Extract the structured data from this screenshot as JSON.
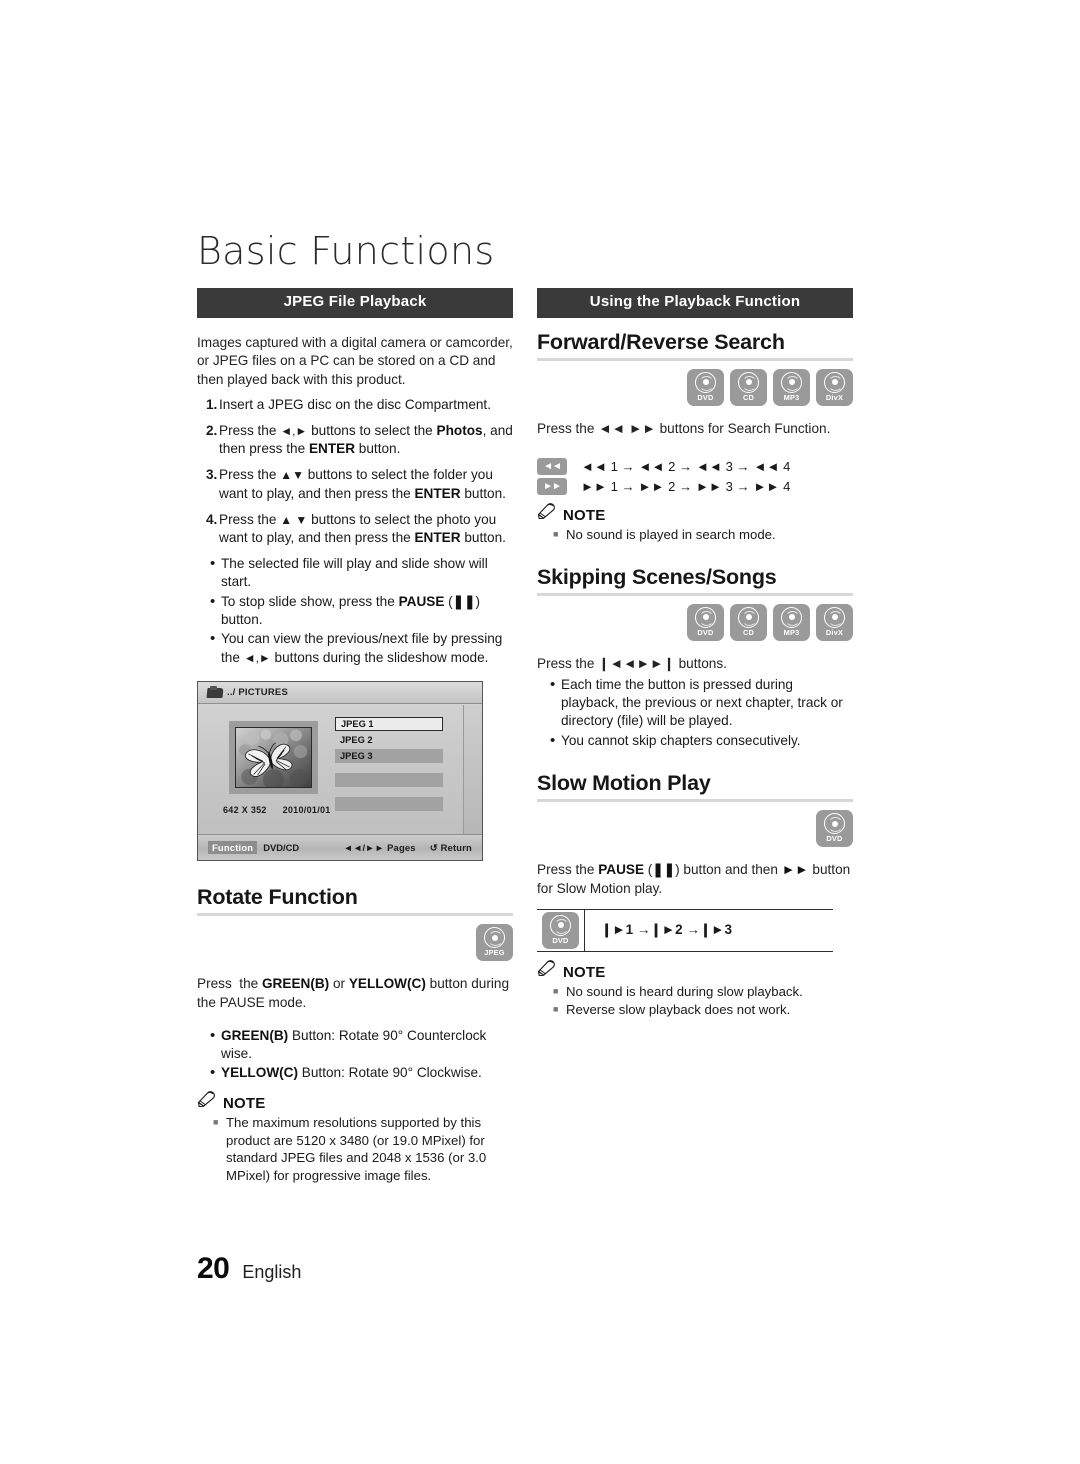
{
  "page": {
    "chapter_title": "Basic Functions",
    "page_number": "20",
    "language": "English"
  },
  "left_column": {
    "section_bar": "JPEG File Playback",
    "intro": "Images captured with a digital camera or camcorder, or JPEG files on a PC can be stored on a CD and then played back with this product.",
    "steps": [
      {
        "num": "1.",
        "text": "Insert a JPEG disc on the disc Compartment."
      },
      {
        "num": "2.",
        "text": "Press the ◄,► buttons to select the Photos, and then press the ENTER button."
      },
      {
        "num": "3.",
        "text": "Press the ▲▼ buttons to select the folder you want to play, and then press the ENTER button."
      },
      {
        "num": "4.",
        "text": "Press the ▲▼ buttons to select the photo you want to play, and then press the ENTER button."
      }
    ],
    "bullets": [
      "The selected file will play and slide show will start.",
      "To stop slide show, press the PAUSE (❚❚) button.",
      "You can view the previous/next file by pressing the ◄,► buttons during the slideshow mode."
    ],
    "osd": {
      "path": "../ PICTURES",
      "folder_icon": "folder-pictures-icon",
      "files": [
        "JPEG 1",
        "JPEG 2",
        "JPEG 3"
      ],
      "resolution": "642 X 352",
      "date": "2010/01/01",
      "function_label": "Function",
      "source_label": "DVD/CD",
      "pages_label": "Pages",
      "pages_glyph": "◄◄/►►",
      "return_label": "Return",
      "return_glyph": "↺"
    },
    "rotate": {
      "heading": "Rotate Function",
      "discs": [
        {
          "name": "jpeg-disc-icon",
          "label": "JPEG"
        }
      ],
      "intro": "Press  the GREEN(B) or YELLOW(C) button during the PAUSE mode.",
      "bullets": [
        "GREEN(B) Button: Rotate 90° Counterclock wise.",
        "YELLOW(C) Button: Rotate 90° Clockwise."
      ]
    },
    "note": {
      "title": "NOTE",
      "items": [
        "The maximum resolutions supported by this product are 5120 x 3480 (or 19.0 MPixel) for standard JPEG files and 2048 x 1536 (or 3.0 MPixel) for progressive image files."
      ]
    }
  },
  "right_column": {
    "section_bar": "Using the Playback Function",
    "forward_reverse": {
      "heading": "Forward/Reverse Search",
      "discs": [
        {
          "name": "dvd-disc-icon",
          "label": "DVD"
        },
        {
          "name": "cd-disc-icon",
          "label": "CD"
        },
        {
          "name": "mp3-disc-icon",
          "label": "MP3"
        },
        {
          "name": "divx-disc-icon",
          "label": "DivX"
        }
      ],
      "intro": "Press the ◄◄ ►► buttons for Search Function.",
      "speed_rows": [
        {
          "key": "◄◄",
          "sequence": "◄◄ 1 → ◄◄ 2 → ◄◄ 3 → ◄◄ 4"
        },
        {
          "key": "►►",
          "sequence": "►► 1 → ►► 2 → ►► 3 → ►► 4"
        }
      ],
      "note": {
        "title": "NOTE",
        "items": [
          "No sound is played in search mode."
        ]
      }
    },
    "skipping": {
      "heading": "Skipping Scenes/Songs",
      "discs": [
        {
          "name": "dvd-disc-icon",
          "label": "DVD"
        },
        {
          "name": "cd-disc-icon",
          "label": "CD"
        },
        {
          "name": "mp3-disc-icon",
          "label": "MP3"
        },
        {
          "name": "divx-disc-icon",
          "label": "DivX"
        }
      ],
      "intro": "Press the ❙◄◄►►❙ buttons.",
      "bullets": [
        "Each time the button is pressed during playback, the previous or next chapter, track or directory (file) will be played.",
        "You cannot skip chapters consecutively."
      ]
    },
    "slow_motion": {
      "heading": "Slow Motion Play",
      "discs": [
        {
          "name": "dvd-disc-icon",
          "label": "DVD"
        }
      ],
      "intro": "Press the PAUSE (❚❚) button and then ►► button for Slow Motion play.",
      "table": {
        "icon": {
          "name": "dvd-disc-icon",
          "label": "DVD"
        },
        "sequence": "❙►1 →❙►2 →❙►3"
      },
      "note": {
        "title": "NOTE",
        "items": [
          "No sound is heard during slow playback.",
          "Reverse slow playback does not work."
        ]
      }
    }
  },
  "colors": {
    "bar_bg": "#3a3a3a",
    "rule": "#d8d8d8",
    "disc_badge": "#9a9a9a",
    "text": "#232323"
  }
}
